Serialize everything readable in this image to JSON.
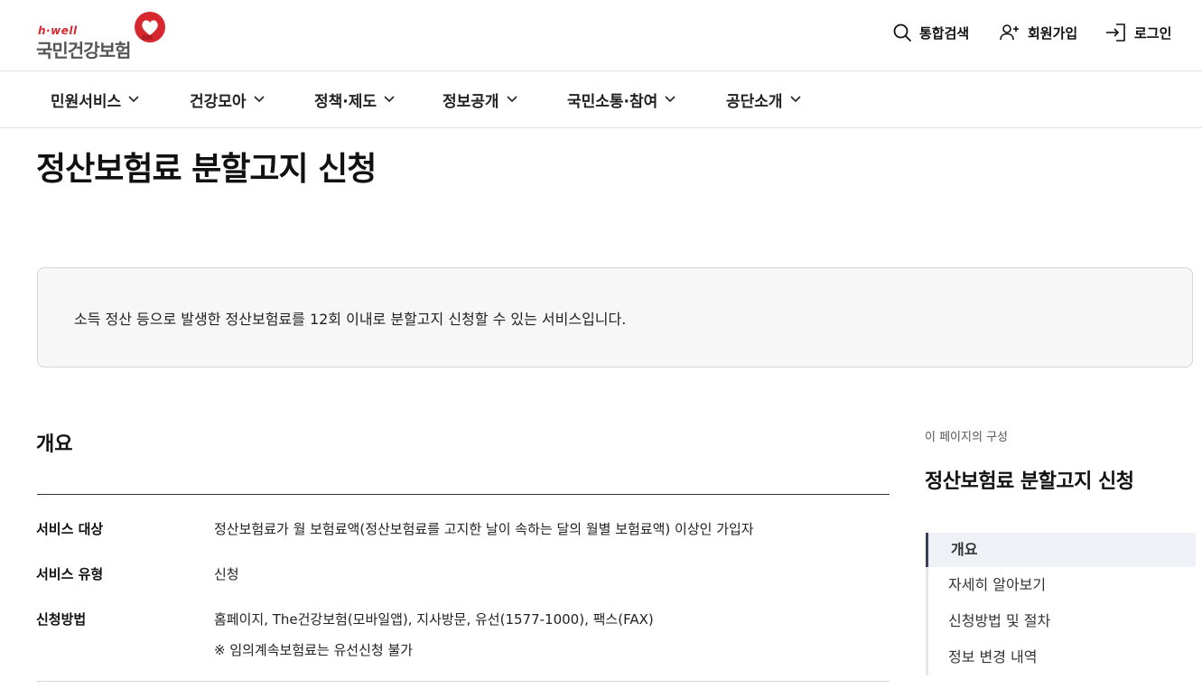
{
  "header": {
    "logo_tag": "h·well",
    "logo_name": "국민건강보험",
    "utility": [
      {
        "icon": "search-icon",
        "label": "통합검색"
      },
      {
        "icon": "user-plus-icon",
        "label": "회원가입"
      },
      {
        "icon": "login-icon",
        "label": "로그인"
      }
    ]
  },
  "nav": {
    "items": [
      "민원서비스",
      "건강모아",
      "정책·제도",
      "정보공개",
      "국민소통·참여",
      "공단소개"
    ]
  },
  "page": {
    "title": "정산보험료 분할고지 신청",
    "description": "소득 정산 등으로 발생한 정산보험료를 12회 이내로 분할고지 신청할 수 있는 서비스입니다."
  },
  "overview": {
    "title": "개요",
    "rows": [
      {
        "label": "서비스 대상",
        "value": "정산보험료가 월 보험료액(정산보험료를 고지한 날이 속하는 달의 월별 보험료액) 이상인 가입자"
      },
      {
        "label": "서비스 유형",
        "value": "신청"
      },
      {
        "label": "신청방법",
        "value": "홈페이지, The건강보험(모바일앱), 지사방문, 유선(1577-1000), 팩스(FAX)",
        "note": "※  임의계속보험료는 유선신청 불가"
      }
    ]
  },
  "toc": {
    "caption": "이 페이지의 구성",
    "title": "정산보험료 분할고지 신청",
    "items": [
      "개요",
      "자세히 알아보기",
      "신청방법 및 절차",
      "정보 변경 내역"
    ],
    "active_index": 0
  },
  "colors": {
    "brand_red": "#d7282f",
    "toc_active_bar": "#3a3f5c"
  }
}
